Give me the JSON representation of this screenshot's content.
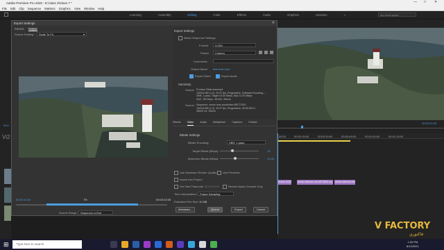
{
  "window": {
    "title": "Adobe Premiere Pro 2020 - E:\\class 3\\Class 7 *",
    "minimize": "—",
    "maximize": "□",
    "close": "✕"
  },
  "menu": [
    "File",
    "Edit",
    "Clip",
    "Sequence",
    "Markers",
    "Graphics",
    "View",
    "Window",
    "Help"
  ],
  "workspaces": {
    "items": [
      "Learning",
      "Assembly",
      "Editing",
      "Color",
      "Effects",
      "Audio",
      "Graphics",
      "Libraries"
    ],
    "active_index": 2,
    "more": "»",
    "search_placeholder": "my work space"
  },
  "export_dialog": {
    "title": "Export Settings",
    "close": "✕",
    "tabs": [
      "Source",
      "Output"
    ],
    "active_tab": "Output",
    "source_scaling_label": "Source Scaling:",
    "source_scaling_value": "Scale To Fit",
    "timecode_in": "00:00:13:20",
    "timecode_out": "00:00:22:05",
    "fit": "Fit",
    "source_range_label": "Source Range:",
    "source_range_value": "Sequence In/Out",
    "settings": {
      "heading": "Export Settings",
      "match_sequence": "Match Sequence Settings",
      "format_label": "Format:",
      "format_value": "H.264",
      "preset_label": "Preset:",
      "preset_value": "Custom",
      "comments_label": "Comments:",
      "output_name_label": "Output Name:",
      "output_name_value": "fast slow.mp4",
      "export_video": "Export Video",
      "export_audio": "Export Audio",
      "summary_heading": "Summary",
      "output_label": "Output:",
      "output_lines": [
        "E:\\class 3\\fast slow.mp4",
        "1920x1080 (1.0), 29.97 fps, Progressive, Software Encoding, ...",
        "VBR, 1 pass, Target 10.00 Mbps, Max 12.00 Mbps",
        "AAC, 320 kbps, 48 kHz, Stereo"
      ],
      "source_label": "Source:",
      "source_lines": [
        "Sequence, venus over production BECTOD0",
        "1920x1080 (1.0), 29.97 fps, Progressive, 00:00:08:12",
        "48000 Hz, Stereo"
      ]
    },
    "sub_tabs": [
      "Effects",
      "Video",
      "Audio",
      "Multiplexer",
      "Captions",
      "Publish"
    ],
    "active_sub_tab": "Video",
    "bitrate": {
      "heading": "Bitrate Settings",
      "encoding_label": "Bitrate Encoding:",
      "encoding_value": "VBR, 1 pass",
      "target_label": "Target Bitrate [Mbps]:",
      "target_value": "10",
      "target_fraction": 0.33,
      "max_label": "Maximum Bitrate [Mbps]:",
      "max_value": "12.00",
      "max_fraction": 0.4
    },
    "options": {
      "max_render_quality": "Use Maximum Render Quality",
      "use_previews": "Use Previews",
      "import_into_project": "Import into Project",
      "set_start_timecode": "Set Start Timecode",
      "start_timecode": "00:00:00:00",
      "render_alpha": "Render Alpha Channel Only",
      "time_interpolation_label": "Time Interpolation:",
      "time_interpolation_value": "Frame Sampling",
      "file_size_label": "Estimated File Size:",
      "file_size_value": "11 MB"
    },
    "buttons": {
      "metadata": "Metadata...",
      "queue": "Queue",
      "export": "Export",
      "cancel": "Cancel"
    }
  },
  "program_monitor": {
    "timecode": "00:00:22:05"
  },
  "left_panel": {
    "timecode": "00:0",
    "vi_label": "Vi2"
  },
  "timeline": {
    "ruler": [
      "00:00",
      "00:00:15:00",
      "00:00:30:00",
      "00:00:45:00",
      "00:01:00:00",
      "00:01:15:00"
    ],
    "clips": [
      "Scene fx2(V)",
      "aerial-minimal-shot-8973824.mp4",
      "aerial-minimal-shot-8..."
    ]
  },
  "watermark": {
    "brand": "V FACTORY",
    "sub": "فاكتوري"
  },
  "taskbar": {
    "search_placeholder": "Type here to search",
    "time": "1:00 PM",
    "date": "8/12/2021"
  },
  "colors": {
    "accent": "#4d9de0",
    "clip": "#9f7ac3",
    "playhead": "#e8d44d"
  }
}
